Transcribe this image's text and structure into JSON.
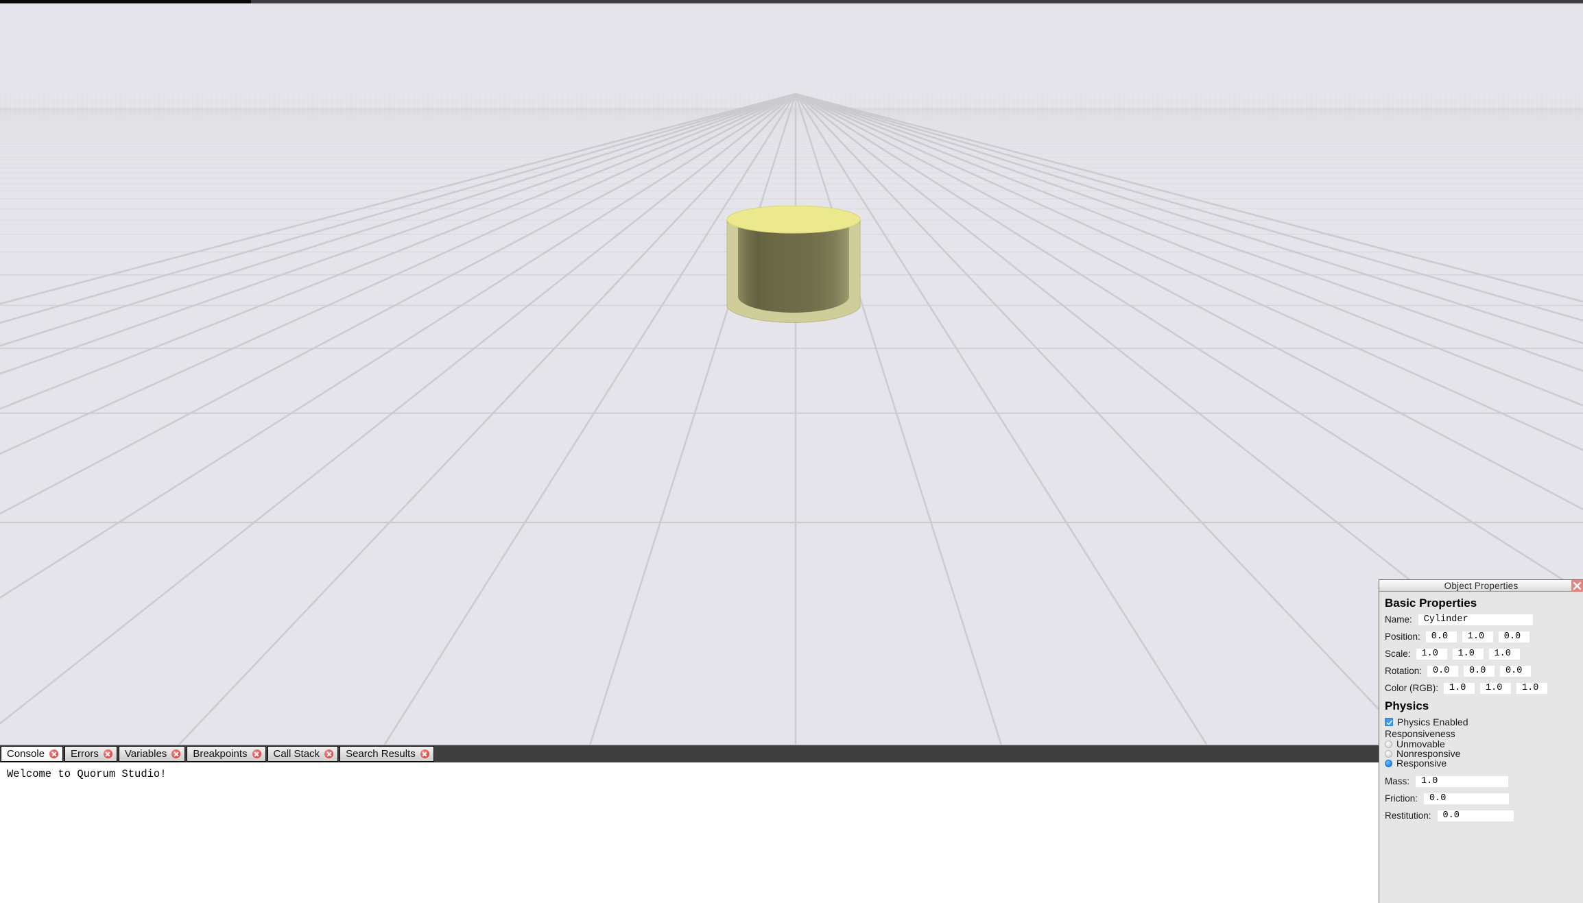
{
  "window": {
    "background_color": "#e5e4ea",
    "top_strip_color": "#3b3b40"
  },
  "viewport": {
    "name": "3d-scene-viewport",
    "grid_line_color": "#c9c9d0",
    "floor_color": "#e5e4ea",
    "object": {
      "type": "cylinder",
      "shell_color": "#cfcd9a",
      "top_face_color": "#ebe88e",
      "interior_color": "#6e6c48",
      "outline_color": "#a9a77a"
    }
  },
  "bottom_panel": {
    "strip_color": "#3e3e3e",
    "tabs": [
      {
        "label": "Console",
        "active": true,
        "close_icon": "close-icon"
      },
      {
        "label": "Errors",
        "active": false,
        "close_icon": "close-icon"
      },
      {
        "label": "Variables",
        "active": false,
        "close_icon": "close-icon"
      },
      {
        "label": "Breakpoints",
        "active": false,
        "close_icon": "close-icon"
      },
      {
        "label": "Call Stack",
        "active": false,
        "close_icon": "close-icon"
      },
      {
        "label": "Search Results",
        "active": false,
        "close_icon": "close-icon"
      }
    ],
    "console": {
      "lines": [
        "Welcome to Quorum Studio!"
      ]
    }
  },
  "object_properties": {
    "title": "Object Properties",
    "close_icon": "close-icon",
    "accent_close_color": "#e8837f",
    "sections": {
      "basic": {
        "heading": "Basic Properties",
        "name": {
          "label": "Name:",
          "value": "Cylinder"
        },
        "position": {
          "label": "Position:",
          "x": "0.0",
          "y": "1.0",
          "z": "0.0"
        },
        "scale": {
          "label": "Scale:",
          "x": "1.0",
          "y": "1.0",
          "z": "1.0"
        },
        "rotation": {
          "label": "Rotation:",
          "x": "0.0",
          "y": "0.0",
          "z": "0.0"
        },
        "color": {
          "label": "Color (RGB):",
          "r": "1.0",
          "g": "1.0",
          "b": "1.0"
        }
      },
      "physics": {
        "heading": "Physics",
        "physics_enabled": {
          "label": "Physics Enabled",
          "checked": true
        },
        "responsiveness": {
          "label": "Responsiveness",
          "options": [
            {
              "label": "Unmovable",
              "selected": false
            },
            {
              "label": "Nonresponsive",
              "selected": false
            },
            {
              "label": "Responsive",
              "selected": true
            }
          ]
        },
        "mass": {
          "label": "Mass:",
          "value": "1.0"
        },
        "friction": {
          "label": "Friction:",
          "value": "0.0"
        },
        "restitution": {
          "label": "Restitution:",
          "value": "0.0"
        }
      }
    }
  }
}
